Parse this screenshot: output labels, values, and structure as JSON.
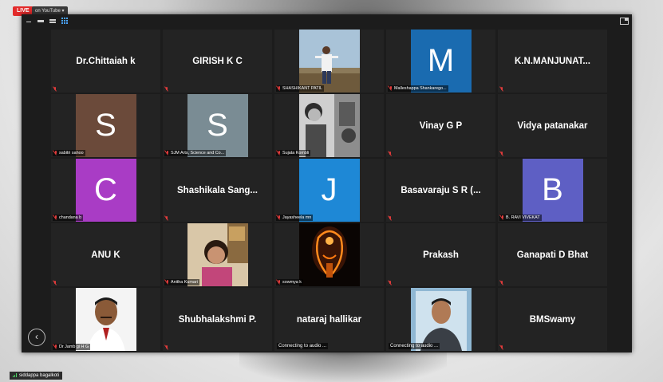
{
  "stream": {
    "live_label": "LIVE",
    "destination": "on YouTube ▾"
  },
  "bottom_user": {
    "name": "siddappa bagalkoti"
  },
  "back_button": {
    "glyph": "‹"
  },
  "colors": {
    "avatar_s_brown": "#6b4a3a",
    "avatar_s_gray": "#7a8c94",
    "avatar_c_purple": "#a93cc5",
    "avatar_j_blue": "#1e88d6",
    "avatar_b_indigo": "#5e5fc4",
    "avatar_m_blue": "#1a6bb0",
    "live_red": "#e32b2b"
  },
  "tiles": [
    {
      "row": 0,
      "col": 0,
      "kind": "name",
      "name": "Dr.Chittaiah k",
      "label": ""
    },
    {
      "row": 0,
      "col": 1,
      "kind": "name",
      "name": "GIRISH K C",
      "label": ""
    },
    {
      "row": 0,
      "col": 2,
      "kind": "photo",
      "photo": "man-outdoors",
      "label": "SHASHIKANT PATIL"
    },
    {
      "row": 0,
      "col": 3,
      "kind": "avatar",
      "letter": "M",
      "color": "#1a6bb0",
      "label": "Malleshappa Shankarego..."
    },
    {
      "row": 0,
      "col": 4,
      "kind": "name",
      "name": "K.N.MANJUNAT...",
      "label": ""
    },
    {
      "row": 1,
      "col": 0,
      "kind": "avatar",
      "letter": "S",
      "color": "#6b4a3a",
      "label": "sabitri sahoo"
    },
    {
      "row": 1,
      "col": 1,
      "kind": "avatar",
      "letter": "S",
      "color": "#7a8c94",
      "label": "SJM Arts, Science and Co..."
    },
    {
      "row": 1,
      "col": 2,
      "kind": "photo",
      "photo": "woman-grayscale",
      "label": "Sujata Kombli"
    },
    {
      "row": 1,
      "col": 3,
      "kind": "name",
      "name": "Vinay G P",
      "label": ""
    },
    {
      "row": 1,
      "col": 4,
      "kind": "name",
      "name": "Vidya patanakar",
      "label": ""
    },
    {
      "row": 2,
      "col": 0,
      "kind": "avatar",
      "letter": "C",
      "color": "#a93cc5",
      "label": "chandana b"
    },
    {
      "row": 2,
      "col": 1,
      "kind": "name",
      "name": "Shashikala  Sang...",
      "label": ""
    },
    {
      "row": 2,
      "col": 2,
      "kind": "avatar",
      "letter": "J",
      "color": "#1e88d6",
      "label": "Jayasheela mn"
    },
    {
      "row": 2,
      "col": 3,
      "kind": "name",
      "name": "Basavaraju  S  R  (...",
      "label": ""
    },
    {
      "row": 2,
      "col": 4,
      "kind": "avatar",
      "letter": "B",
      "color": "#5e5fc4",
      "label": "B. RAVI VIVEKAT"
    },
    {
      "row": 3,
      "col": 0,
      "kind": "name",
      "name": "ANU K",
      "label": ""
    },
    {
      "row": 3,
      "col": 1,
      "kind": "photo",
      "photo": "woman-smiling",
      "label": "Anitha Kumari"
    },
    {
      "row": 3,
      "col": 2,
      "kind": "photo",
      "photo": "deity-orange",
      "label": "sowmya k"
    },
    {
      "row": 3,
      "col": 3,
      "kind": "name",
      "name": "Prakash",
      "label": ""
    },
    {
      "row": 3,
      "col": 4,
      "kind": "name",
      "name": "Ganapati D Bhat",
      "label": ""
    },
    {
      "row": 4,
      "col": 0,
      "kind": "photo",
      "photo": "man-portrait",
      "label": "Dr Jamb gi H G"
    },
    {
      "row": 4,
      "col": 1,
      "kind": "name",
      "name": "Shubhalakshmi P.",
      "label": ""
    },
    {
      "row": 4,
      "col": 2,
      "kind": "name",
      "name": "nataraj hallikar",
      "label": "",
      "audio": "Connecting to audio ..."
    },
    {
      "row": 4,
      "col": 3,
      "kind": "photo",
      "photo": "man-young",
      "label": "",
      "audio": "Connecting to audio ..."
    },
    {
      "row": 4,
      "col": 4,
      "kind": "name",
      "name": "BMSwamy",
      "label": ""
    }
  ]
}
